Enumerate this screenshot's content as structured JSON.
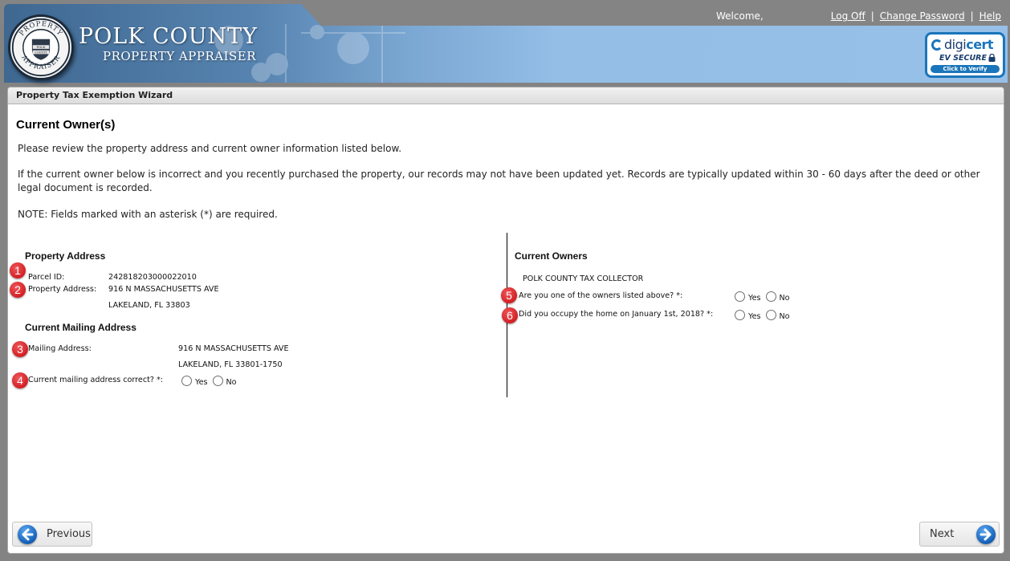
{
  "header": {
    "logo_title": "POLK COUNTY",
    "logo_subtitle": "PROPERTY APPRAISER",
    "seal_top": "PROPERTY",
    "seal_bottom": "APPRAISER",
    "seal_center_line1": "POLK",
    "seal_center_line2": "COUNTY",
    "welcome": "Welcome,",
    "links": [
      {
        "label": "Log Off"
      },
      {
        "label": "Change Password"
      },
      {
        "label": "Help"
      }
    ],
    "separator": "|",
    "badge": {
      "brand_a": "digi",
      "brand_b": "cert",
      "line2": "EV SECURE",
      "cta": "Click to Verify"
    }
  },
  "panel": {
    "title": "Property Tax Exemption Wizard",
    "page_title": "Current Owner(s)",
    "intro": [
      "Please review the property address and current owner information listed below.",
      "If the current owner below is incorrect and you recently purchased the property, our records may not have been updated yet. Records are typically updated within 30 - 60 days after the deed or other legal document is recorded.",
      "NOTE: Fields marked with an asterisk (*) are required."
    ]
  },
  "property": {
    "section_title": "Property Address",
    "parcel_label": "Parcel ID:",
    "parcel_value": "242818203000022010",
    "address_label": "Property Address:",
    "address_line1": "916 N MASSACHUSETTS AVE",
    "address_line2": "LAKELAND, FL 33803"
  },
  "mailing": {
    "section_title": "Current Mailing Address",
    "address_label": "Mailing Address:",
    "address_line1": "916 N MASSACHUSETTS AVE",
    "address_line2": "LAKELAND, FL 33801-1750",
    "question": "Current mailing address correct? *:"
  },
  "owners": {
    "section_title": "Current Owners",
    "owner_name": "POLK COUNTY TAX COLLECTOR",
    "question_owner": "Are you one of the owners listed above? *:",
    "question_occupy": "Did you occupy the home on January 1st, 2018? *:"
  },
  "radio_options": {
    "yes": "Yes",
    "no": "No"
  },
  "annotations": [
    "1",
    "2",
    "3",
    "4",
    "5",
    "6"
  ],
  "nav": {
    "previous": "Previous",
    "next": "Next"
  },
  "colors": {
    "accent_blue": "#1b75bb",
    "badge_red": "#d21f24",
    "header_gray": "#838383"
  }
}
